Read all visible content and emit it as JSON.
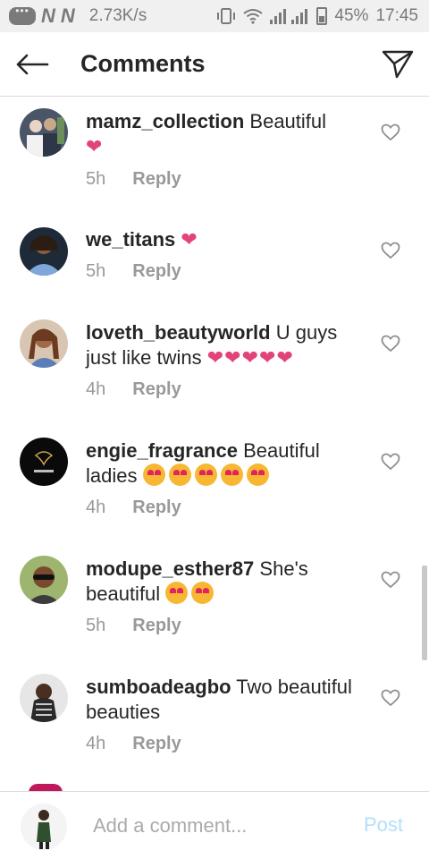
{
  "status_bar": {
    "net_speed": "2.73K/s",
    "network_letters": [
      "N",
      "N"
    ],
    "battery": "45%",
    "time": "17:45"
  },
  "header": {
    "title": "Comments",
    "back_icon": "arrow-left-icon",
    "send_icon": "paper-plane-icon"
  },
  "comments": [
    {
      "username": "mamz_collection",
      "text": "Beautiful",
      "emoji": "❤",
      "time": "5h",
      "reply": "Reply"
    },
    {
      "username": "we_titans",
      "text": "",
      "emoji": "❤",
      "time": "5h",
      "reply": "Reply"
    },
    {
      "username": "loveth_beautyworld",
      "text": "U guys just like twins",
      "emoji": "❤❤❤❤❤",
      "time": "4h",
      "reply": "Reply"
    },
    {
      "username": "engie_fragrance",
      "text": "Beautiful ladies",
      "emoji": "😍😍😍😍😍",
      "time": "4h",
      "reply": "Reply"
    },
    {
      "username": "modupe_esther87",
      "text": "She's beautiful",
      "emoji": "😍😍",
      "time": "5h",
      "reply": "Reply"
    },
    {
      "username": "sumboadeagbo",
      "text": "Two beautiful beauties",
      "emoji": "",
      "time": "4h",
      "reply": "Reply"
    }
  ],
  "input": {
    "placeholder": "Add a comment...",
    "post_label": "Post"
  },
  "colors": {
    "heart": "#e2447a",
    "post_disabled": "#b2dffc",
    "meta_gray": "#999999"
  }
}
